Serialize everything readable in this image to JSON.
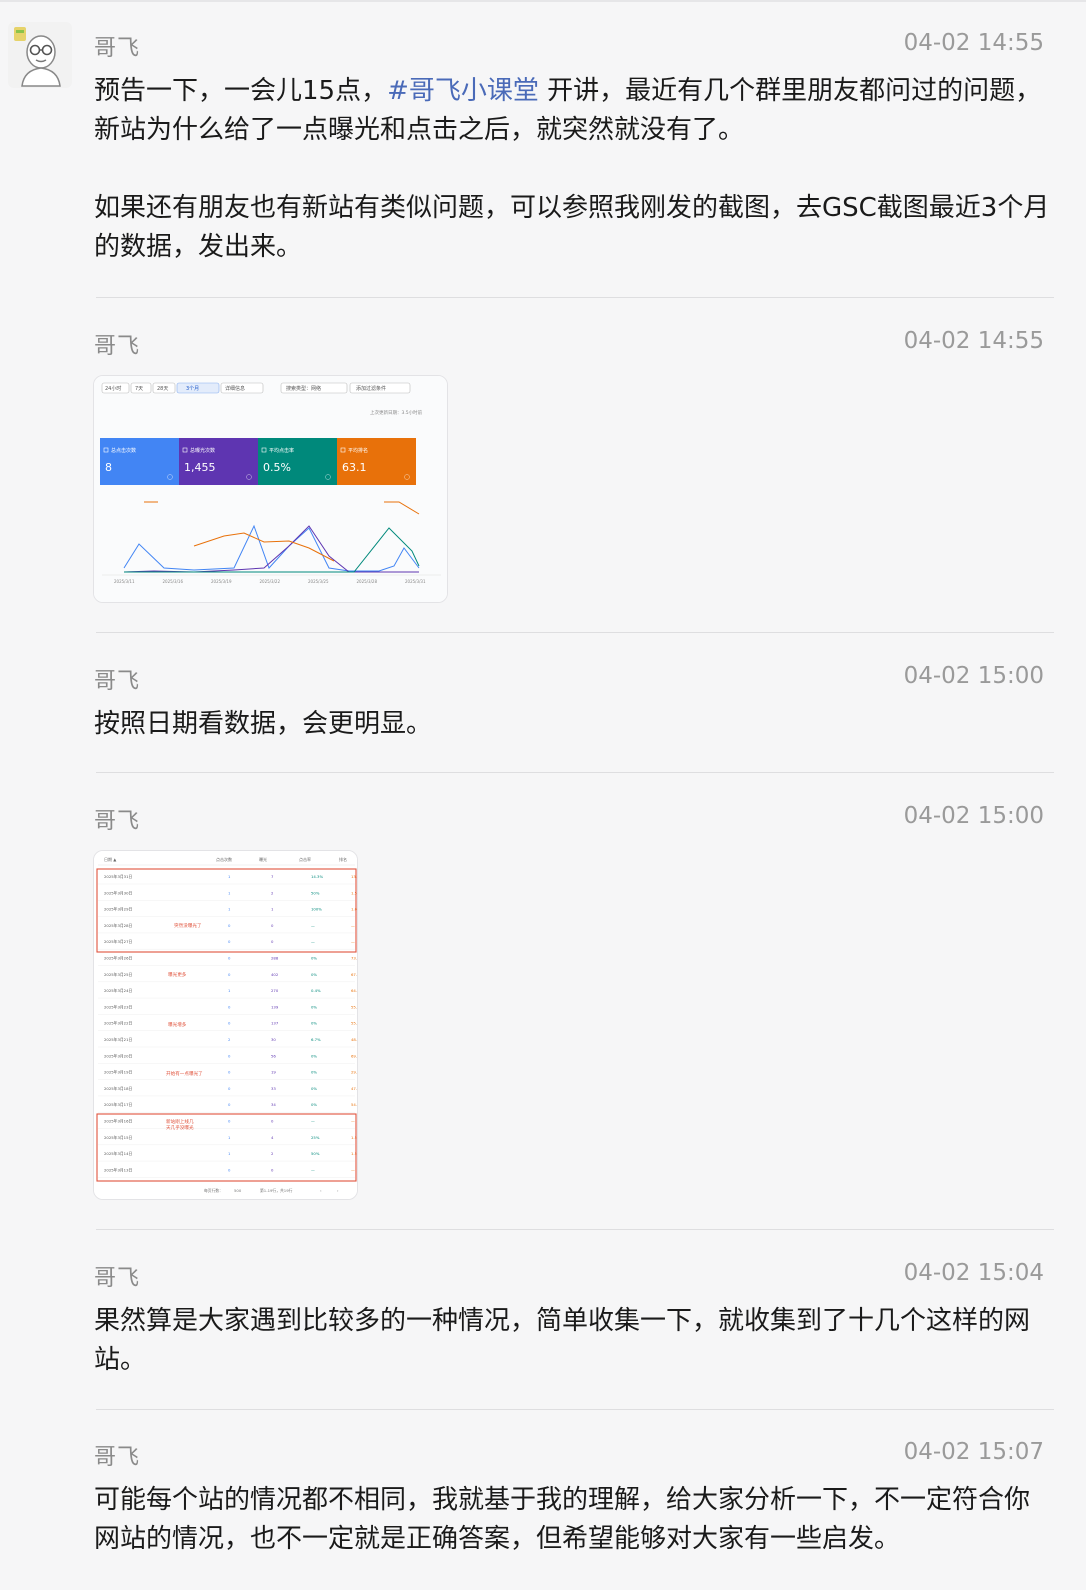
{
  "messages": [
    {
      "author": "哥飞",
      "time": "04-02 14:55",
      "paragraphs": [
        {
          "pre": "预告一下，一会儿15点，",
          "tag": "#哥飞小课堂",
          "post": " 开讲，最近有几个群里朋友都问过的问题，新站为什么给了一点曝光和点击之后，就突然就没有了。"
        },
        {
          "pre": "如果还有朋友也有新站有类似问题，可以参照我刚发的截图，去GSC截图最近3个月的数据，发出来。",
          "tag": "",
          "post": ""
        }
      ]
    },
    {
      "author": "哥飞",
      "time": "04-02 14:55"
    },
    {
      "author": "哥飞",
      "time": "04-02 15:00",
      "text": "按照日期看数据，会更明显。"
    },
    {
      "author": "哥飞",
      "time": "04-02 15:00"
    },
    {
      "author": "哥飞",
      "time": "04-02 15:04",
      "text": "果然算是大家遇到比较多的一种情况，简单收集一下，就收集到了十几个这样的网站。"
    },
    {
      "author": "哥飞",
      "time": "04-02 15:07",
      "text": "可能每个站的情况都不相同，我就基于我的理解，给大家分析一下，不一定符合你网站的情况，也不一定就是正确答案，但希望能够对大家有一些启发。"
    }
  ],
  "gsc_chart": {
    "range_tabs": [
      "24小时",
      "7天",
      "28天",
      "3个月",
      "详细信息"
    ],
    "active_tab": "3个月",
    "filters": [
      "搜索类型：网络",
      "添加过滤条件"
    ],
    "updated": "上次更新日期：3.5小时前",
    "cards": [
      {
        "label": "总点击次数",
        "value": "8",
        "color": "#4285f4"
      },
      {
        "label": "总曝光次数",
        "value": "1,455",
        "color": "#5e35b1"
      },
      {
        "label": "平均点击率",
        "value": "0.5%",
        "color": "#00897b"
      },
      {
        "label": "平均排名",
        "value": "63.1",
        "color": "#e8710a"
      }
    ],
    "x_labels": [
      "2025/3/11",
      "2025/3/16",
      "2025/3/19",
      "2025/3/22",
      "2025/3/25",
      "2025/3/28",
      "2025/3/31"
    ]
  },
  "gsc_table": {
    "headers": [
      "日期",
      "点击次数",
      "曝光",
      "点击率",
      "排名"
    ],
    "rows": [
      [
        "2025年3月31日",
        "1",
        "7",
        "14.3%",
        "13.3"
      ],
      [
        "2025年3月30日",
        "1",
        "2",
        "50%",
        "1.5"
      ],
      [
        "2025年3月29日",
        "1",
        "1",
        "100%",
        "1.0"
      ],
      [
        "2025年3月28日",
        "0",
        "0",
        "—",
        "—"
      ],
      [
        "2025年3月27日",
        "0",
        "0",
        "—",
        "—"
      ],
      [
        "2025年3月26日",
        "0",
        "288",
        "0%",
        "73.5"
      ],
      [
        "2025年3月25日",
        "0",
        "402",
        "0%",
        "67.4"
      ],
      [
        "2025年3月24日",
        "1",
        "270",
        "0.4%",
        "64.0"
      ],
      [
        "2025年3月23日",
        "0",
        "139",
        "0%",
        "55.8"
      ],
      [
        "2025年3月22日",
        "0",
        "137",
        "0%",
        "55.6"
      ],
      [
        "2025年3月21日",
        "2",
        "30",
        "6.7%",
        "48.9"
      ],
      [
        "2025年3月20日",
        "0",
        "56",
        "0%",
        "69.9"
      ],
      [
        "2025年3月19日",
        "0",
        "19",
        "0%",
        "29.8"
      ],
      [
        "2025年3月18日",
        "0",
        "33",
        "0%",
        "47.6"
      ],
      [
        "2025年3月17日",
        "0",
        "34",
        "0%",
        "54.0"
      ],
      [
        "2025年3月16日",
        "0",
        "0",
        "—",
        "—"
      ],
      [
        "2025年3月15日",
        "1",
        "4",
        "25%",
        "1.5"
      ],
      [
        "2025年3月14日",
        "1",
        "2",
        "50%",
        "1.5"
      ],
      [
        "2025年3月13日",
        "0",
        "0",
        "—",
        "—"
      ]
    ],
    "annotations": [
      "突然没曝光了",
      "曝光更多",
      "曝光增多",
      "开始有一点曝光了",
      "新站刚上线几天几乎没曝光"
    ],
    "footer": [
      "每页行数：",
      "500",
      "第1-19行，共19行"
    ]
  }
}
